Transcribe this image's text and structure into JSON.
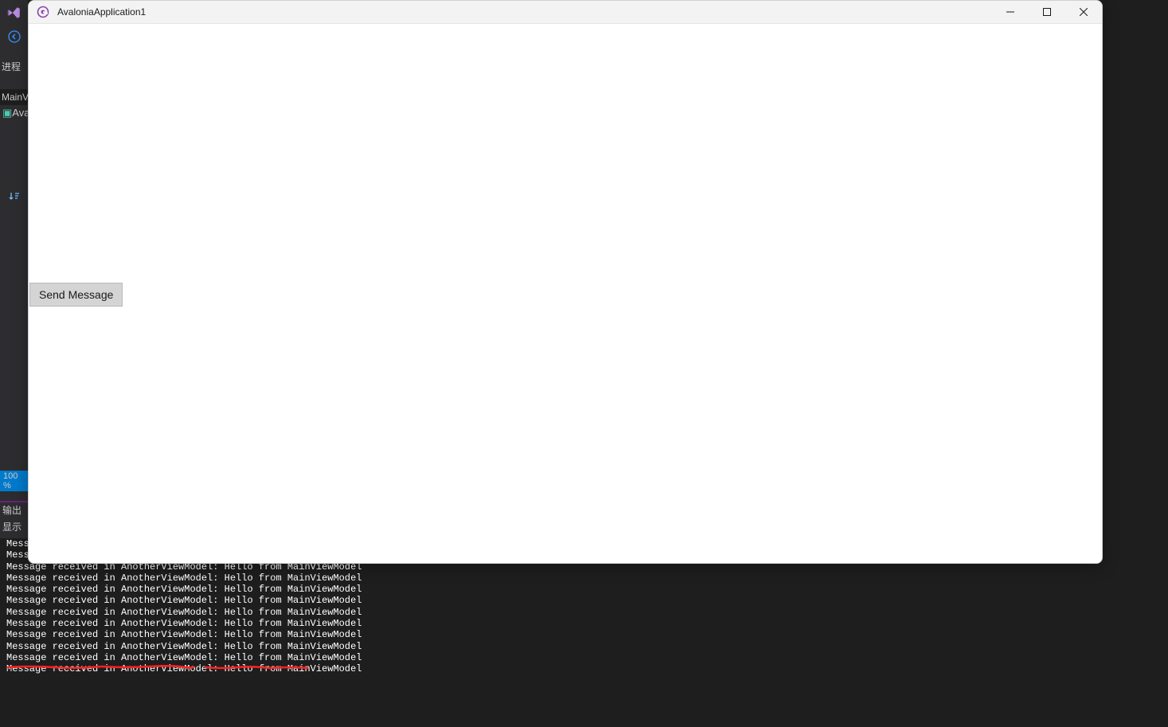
{
  "vs": {
    "process_label": "进程",
    "mainv_label": "MainV",
    "ava_label": "Ava",
    "zoom": "100 %",
    "output_label": "输出",
    "show_label": "显示"
  },
  "window": {
    "title": "AvaloniaApplication1"
  },
  "content": {
    "send_button": "Send Message"
  },
  "console": {
    "lines": [
      "Mess",
      "Mess",
      "Message received in AnotherViewModel: Hello from MainViewModel",
      "Message received in AnotherViewModel: Hello from MainViewModel",
      "Message received in AnotherViewModel: Hello from MainViewModel",
      "Message received in AnotherViewModel: Hello from MainViewModel",
      "Message received in AnotherViewModel: Hello from MainViewModel",
      "Message received in AnotherViewModel: Hello from MainViewModel",
      "Message received in AnotherViewModel: Hello from MainViewModel",
      "Message received in AnotherViewModel: Hello from MainViewModel",
      "Message received in AnotherViewModel: Hello from MainViewModel",
      "Message received in AnotherViewModel: Hello from MainViewModel"
    ]
  }
}
